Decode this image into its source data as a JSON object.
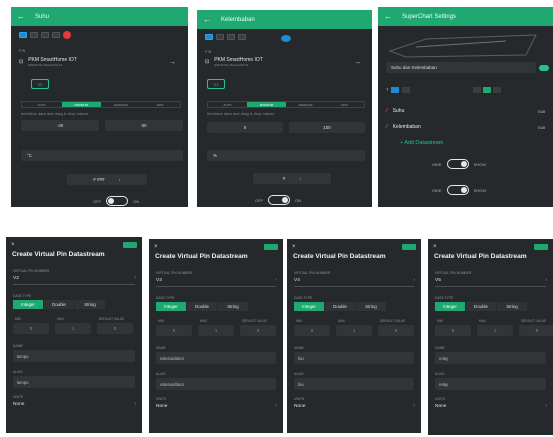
{
  "widgets": [
    {
      "title": "Suhu",
      "section_label": "PIN",
      "device_name": "PKM SmartHome IOT",
      "device_sub": "ESP32 Dev Board (Wi-Fi)",
      "pin": "V0",
      "swatch_color": "#e03b3b",
      "range_hint": "Interface data and drag & drop values",
      "min": "-40",
      "max": "80",
      "unit": "°C",
      "sort_value": "# ###",
      "toggle_off": "OFF",
      "toggle_on": "ON"
    },
    {
      "title": "Kelembaban",
      "section_label": "PIN",
      "device_name": "PKM SmartHome IOT",
      "device_sub": "ESP32 Dev Board (Wi-Fi)",
      "pin": "V1",
      "swatch_color": "#1a8ccf",
      "range_hint": "Interface data and drag & drop values",
      "min": "0",
      "max": "100",
      "unit": "%",
      "sort_value": "#",
      "toggle_off": "OFF",
      "toggle_on": "ON"
    }
  ],
  "chart": {
    "title": "SuperChart Settings",
    "name_value": "Suhu dan Kelembaban",
    "range_label": "T",
    "streams": [
      {
        "name": "Suhu",
        "edit": "Edit",
        "color": "#e03b3b"
      },
      {
        "name": "Kelembaban",
        "edit": "Edit",
        "color": "#1a8ccf"
      }
    ],
    "add_label": "+ Add Datastream",
    "hide_label": "HIDE",
    "show_label": "SHOW"
  },
  "segment_labels": [
    "AUTO",
    "MINIMUM",
    "AVERAGE",
    "MAX"
  ],
  "datastreams": [
    {
      "title": "Create Virtual Pin Datastream",
      "pin_label": "VIRTUAL PIN NUMBER",
      "pin": "V2",
      "data_type_label": "DATA TYPE",
      "types": [
        "Integer",
        "Double",
        "String"
      ],
      "min_label": "MIN",
      "max_label": "MAX",
      "default_label": "DEFAULT VALUE",
      "min": "0",
      "max": "1",
      "default": "0",
      "name_label": "NAME",
      "name": "lampu",
      "alias_label": "ALIAS",
      "alias": "lampu",
      "units_label": "UNITS",
      "units": "None"
    },
    {
      "title": "Create Virtual Pin Datastream",
      "pin_label": "VIRTUAL PIN NUMBER",
      "pin": "V3",
      "data_type_label": "DATA TYPE",
      "types": [
        "Integer",
        "Double",
        "String"
      ],
      "min_label": "MIN",
      "max_label": "MAX",
      "default_label": "DEFAULT VALUE",
      "min": "0",
      "max": "1",
      "default": "0",
      "name_label": "NAME",
      "name": "solenoiddoor",
      "alias_label": "ALIAS",
      "alias": "solenoiddoor",
      "units_label": "UNITS",
      "units": "None"
    },
    {
      "title": "Create Virtual Pin Datastream",
      "pin_label": "VIRTUAL PIN NUMBER",
      "pin": "V4",
      "data_type_label": "DATA TYPE",
      "types": [
        "Integer",
        "Double",
        "String"
      ],
      "min_label": "MIN",
      "max_label": "MAX",
      "default_label": "DEFAULT VALUE",
      "min": "0",
      "max": "1",
      "default": "0",
      "name_label": "NAME",
      "name": "fan",
      "alias_label": "ALIAS",
      "alias": "fan",
      "units_label": "UNITS",
      "units": "None"
    },
    {
      "title": "Create Virtual Pin Datastream",
      "pin_label": "VIRTUAL PIN NUMBER",
      "pin": "V5",
      "data_type_label": "DATA TYPE",
      "types": [
        "Integer",
        "Double",
        "String"
      ],
      "min_label": "MIN",
      "max_label": "MAX",
      "default_label": "DEFAULT VALUE",
      "min": "0",
      "max": "1",
      "default": "0",
      "name_label": "NAME",
      "name": "relay",
      "alias_label": "ALIAS",
      "alias": "relay",
      "units_label": "UNITS",
      "units": "None"
    }
  ]
}
